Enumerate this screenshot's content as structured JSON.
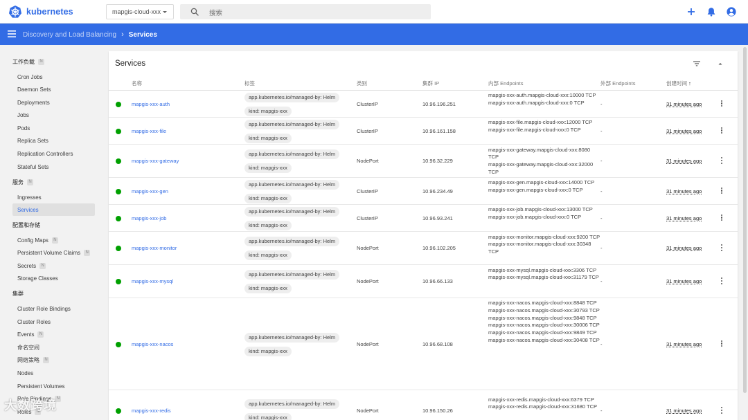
{
  "app": {
    "name": "kubernetes"
  },
  "namespace": {
    "selected": "mapgis-cloud-xxx"
  },
  "search": {
    "placeholder": "搜索"
  },
  "breadcrumb": {
    "parent": "Discovery and Load Balancing",
    "current": "Services"
  },
  "sidebar": {
    "sections": [
      {
        "label": "工作负载",
        "badge": "N",
        "items": [
          {
            "label": "Cron Jobs"
          },
          {
            "label": "Daemon Sets"
          },
          {
            "label": "Deployments"
          },
          {
            "label": "Jobs"
          },
          {
            "label": "Pods"
          },
          {
            "label": "Replica Sets"
          },
          {
            "label": "Replication Controllers"
          },
          {
            "label": "Stateful Sets"
          }
        ]
      },
      {
        "label": "服务",
        "badge": "N",
        "items": [
          {
            "label": "Ingresses"
          },
          {
            "label": "Services",
            "active": true
          }
        ]
      },
      {
        "label": "配置和存储",
        "items": [
          {
            "label": "Config Maps",
            "badge": "N"
          },
          {
            "label": "Persistent Volume Claims",
            "badge": "N"
          },
          {
            "label": "Secrets",
            "badge": "N"
          },
          {
            "label": "Storage Classes"
          }
        ]
      },
      {
        "label": "集群",
        "items": [
          {
            "label": "Cluster Role Bindings"
          },
          {
            "label": "Cluster Roles"
          },
          {
            "label": "Events",
            "badge": "N"
          },
          {
            "label": "命名空间"
          },
          {
            "label": "网络策略",
            "badge": "N"
          },
          {
            "label": "Nodes"
          },
          {
            "label": "Persistent Volumes"
          },
          {
            "label": "Role Bindings",
            "badge": "N"
          },
          {
            "label": "Roles",
            "badge": "N"
          }
        ]
      }
    ]
  },
  "card": {
    "title": "Services"
  },
  "table": {
    "columns": {
      "name": "名称",
      "labels": "标签",
      "type": "类别",
      "cluster_ip": "集群 IP",
      "internal_endpoints": "内部 Endpoints",
      "external_endpoints": "外部 Endpoints",
      "created": "创建时间"
    },
    "sort_arrow": "↑",
    "rows": [
      {
        "name": "mapgis-xxx-auth",
        "labels": [
          "app.kubernetes.io/managed-by: Helm",
          "kind: mapgis-xxx"
        ],
        "type": "ClusterIP",
        "ip": "10.96.196.251",
        "endpoints": [
          "mapgis-xxx-auth.mapgis-cloud-xxx:10000 TCP",
          "mapgis-xxx-auth.mapgis-cloud-xxx:0 TCP"
        ],
        "external": "-",
        "age": "31 minutes ago"
      },
      {
        "name": "mapgis-xxx-file",
        "labels": [
          "app.kubernetes.io/managed-by: Helm",
          "kind: mapgis-xxx"
        ],
        "type": "ClusterIP",
        "ip": "10.96.161.158",
        "endpoints": [
          "mapgis-xxx-file.mapgis-cloud-xxx:12000 TCP",
          "mapgis-xxx-file.mapgis-cloud-xxx:0 TCP"
        ],
        "external": "-",
        "age": "31 minutes ago"
      },
      {
        "name": "mapgis-xxx-gateway",
        "labels": [
          "app.kubernetes.io/managed-by: Helm",
          "kind: mapgis-xxx"
        ],
        "type": "NodePort",
        "ip": "10.96.32.229",
        "endpoints": [
          "mapgis-xxx-gateway.mapgis-cloud-xxx:8080 TCP",
          "mapgis-xxx-gateway.mapgis-cloud-xxx:32000 TCP"
        ],
        "external": "-",
        "age": "31 minutes ago"
      },
      {
        "name": "mapgis-xxx-gen",
        "labels": [
          "app.kubernetes.io/managed-by: Helm",
          "kind: mapgis-xxx"
        ],
        "type": "ClusterIP",
        "ip": "10.96.234.49",
        "endpoints": [
          "mapgis-xxx-gen.mapgis-cloud-xxx:14000 TCP",
          "mapgis-xxx-gen.mapgis-cloud-xxx:0 TCP"
        ],
        "external": "-",
        "age": "31 minutes ago"
      },
      {
        "name": "mapgis-xxx-job",
        "labels": [
          "app.kubernetes.io/managed-by: Helm",
          "kind: mapgis-xxx"
        ],
        "type": "ClusterIP",
        "ip": "10.96.93.241",
        "endpoints": [
          "mapgis-xxx-job.mapgis-cloud-xxx:13000 TCP",
          "mapgis-xxx-job.mapgis-cloud-xxx:0 TCP"
        ],
        "external": "-",
        "age": "31 minutes ago"
      },
      {
        "name": "mapgis-xxx-monitor",
        "labels": [
          "app.kubernetes.io/managed-by: Helm",
          "kind: mapgis-xxx"
        ],
        "type": "NodePort",
        "ip": "10.96.102.205",
        "endpoints": [
          "mapgis-xxx-monitor.mapgis-cloud-xxx:9200 TCP",
          "mapgis-xxx-monitor.mapgis-cloud-xxx:30348 TCP"
        ],
        "external": "-",
        "age": "31 minutes ago"
      },
      {
        "name": "mapgis-xxx-mysql",
        "labels": [
          "app.kubernetes.io/managed-by: Helm",
          "kind: mapgis-xxx"
        ],
        "type": "NodePort",
        "ip": "10.96.66.133",
        "endpoints": [
          "mapgis-xxx-mysql.mapgis-cloud-xxx:3306 TCP",
          "mapgis-xxx-mysql.mapgis-cloud-xxx:31179 TCP"
        ],
        "external": "-",
        "age": "31 minutes ago"
      },
      {
        "name": "mapgis-xxx-nacos",
        "labels": [
          "app.kubernetes.io/managed-by: Helm",
          "kind: mapgis-xxx"
        ],
        "type": "NodePort",
        "ip": "10.96.68.108",
        "endpoints": [
          "mapgis-xxx-nacos.mapgis-cloud-xxx:8848 TCP",
          "mapgis-xxx-nacos.mapgis-cloud-xxx:30793 TCP",
          "mapgis-xxx-nacos.mapgis-cloud-xxx:9848 TCP",
          "mapgis-xxx-nacos.mapgis-cloud-xxx:30006 TCP",
          "mapgis-xxx-nacos.mapgis-cloud-xxx:9849 TCP",
          "mapgis-xxx-nacos.mapgis-cloud-xxx:30408 TCP"
        ],
        "external": "-",
        "age": "31 minutes ago"
      },
      {
        "name": "mapgis-xxx-redis",
        "labels": [
          "app.kubernetes.io/managed-by: Helm",
          "kind: mapgis-xxx"
        ],
        "type": "NodePort",
        "ip": "10.96.150.26",
        "endpoints": [
          "mapgis-xxx-redis.mapgis-cloud-xxx:6379 TCP",
          "mapgis-xxx-redis.mapgis-cloud-xxx:31680 TCP"
        ],
        "external": "-",
        "age": "31 minutes ago"
      }
    ]
  },
  "watermark": "大数跨境",
  "colors": {
    "brand": "#326ce5",
    "status_ok": "#00a000"
  },
  "icons": [
    "kubernetes-logo-icon",
    "search-icon",
    "add-icon",
    "bell-icon",
    "account-icon",
    "menu-icon",
    "filter-icon",
    "collapse-icon",
    "more-vert-icon"
  ]
}
